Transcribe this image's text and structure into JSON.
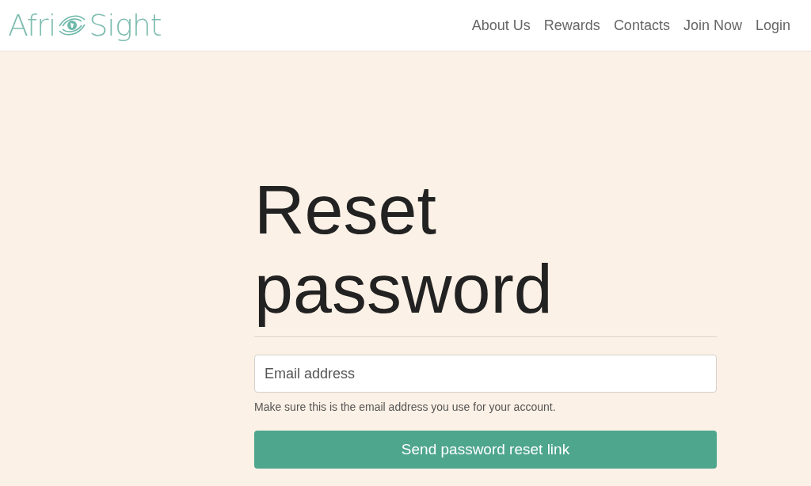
{
  "logo": {
    "left": "Afri",
    "right": "Sight"
  },
  "nav": [
    {
      "label": "About Us"
    },
    {
      "label": "Rewards"
    },
    {
      "label": "Contacts"
    },
    {
      "label": "Join Now"
    },
    {
      "label": "Login"
    }
  ],
  "heading": "Reset password",
  "email_field": {
    "placeholder": "Email address"
  },
  "help_text": "Make sure this is the email address you use for your account.",
  "submit_button": "Send password reset link"
}
